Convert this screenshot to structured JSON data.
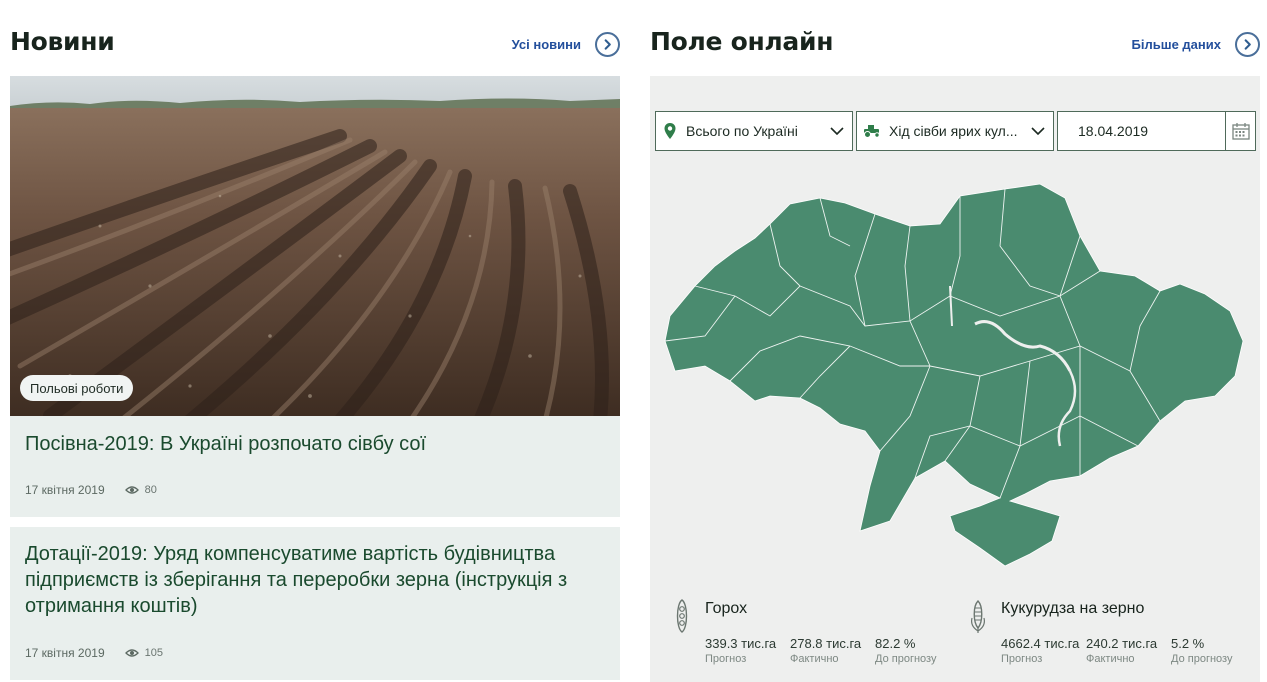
{
  "news": {
    "title": "Новини",
    "all_link": "Усі новини",
    "items": [
      {
        "tag": "Польові роботи",
        "title": "Посівна-2019: В Україні розпочато сівбу сої",
        "date": "17 квітня 2019",
        "views": "80"
      },
      {
        "title": "Дотації-2019: Уряд компенсуватиме вартість будівництва підприємств із зберігання та переробки зерна (інструкція з отримання коштів)",
        "date": "17 квітня 2019",
        "views": "105"
      }
    ]
  },
  "field": {
    "title": "Поле онлайн",
    "more_link": "Більше даних",
    "filters": {
      "region": "Всього по Україні",
      "crop": "Хід сівби ярих кул...",
      "date": "18.04.2019"
    },
    "map_color": "#4a8b6f",
    "crops": [
      {
        "name": "Горох",
        "icon": "pea-icon",
        "forecast": "339.3 тис.га",
        "forecast_label": "Прогноз",
        "actual": "278.8 тис.га",
        "actual_label": "Фактично",
        "percent": "82.2 %",
        "percent_label": "До прогнозу"
      },
      {
        "name": "Кукурудза на зерно",
        "icon": "corn-icon",
        "forecast": "4662.4 тис.га",
        "forecast_label": "Прогноз",
        "actual": "240.2 тис.га",
        "actual_label": "Фактично",
        "percent": "5.2 %",
        "percent_label": "До прогнозу"
      }
    ]
  },
  "colors": {
    "accent_green": "#1a4a2e",
    "link_blue": "#234f9c",
    "card_bg": "#e9efed",
    "map_green": "#4a8b6f"
  }
}
